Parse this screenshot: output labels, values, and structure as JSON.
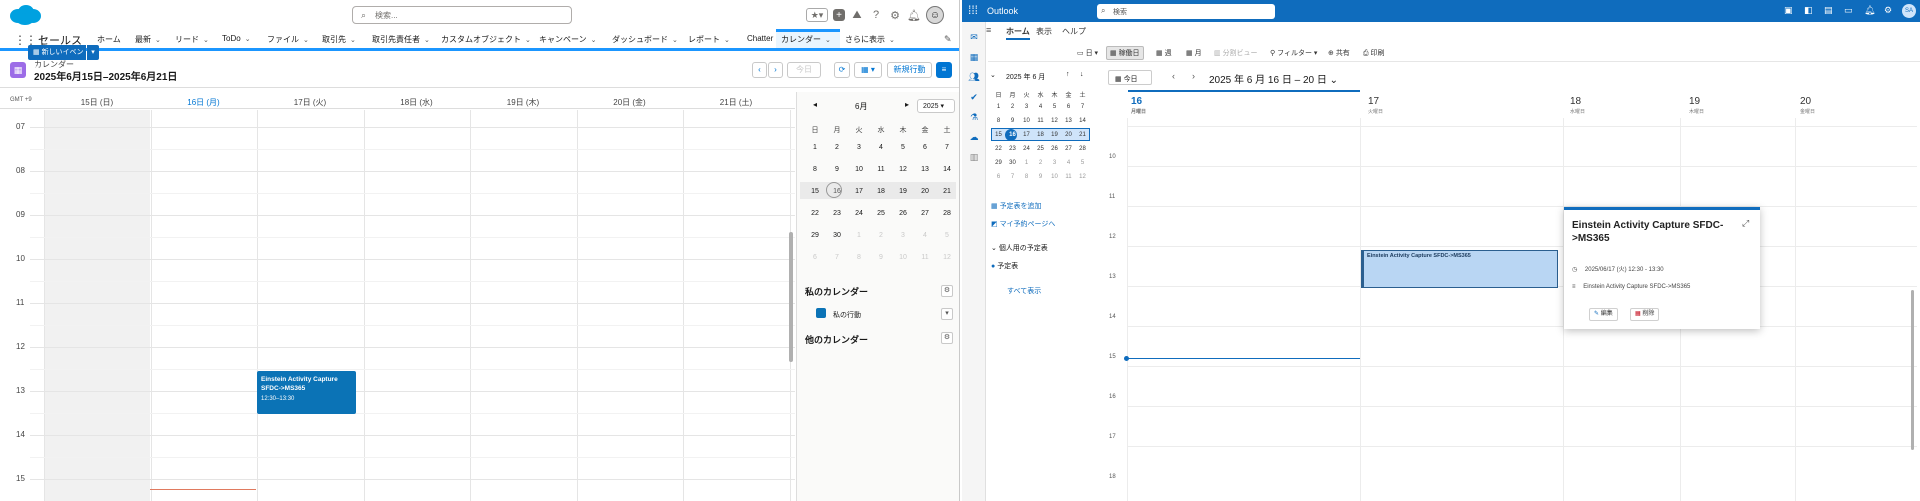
{
  "salesforce": {
    "app_name": "セールス",
    "search_placeholder": "検索...",
    "nav": [
      {
        "label": "ホーム",
        "dd": false
      },
      {
        "label": "最新",
        "dd": true
      },
      {
        "label": "リード",
        "dd": true
      },
      {
        "label": "ToDo",
        "dd": true
      },
      {
        "label": "ファイル",
        "dd": true
      },
      {
        "label": "取引先",
        "dd": true
      },
      {
        "label": "取引先責任者",
        "dd": true
      },
      {
        "label": "カスタムオブジェクト",
        "dd": true
      },
      {
        "label": "キャンペーン",
        "dd": true
      },
      {
        "label": "ダッシュボード",
        "dd": true
      },
      {
        "label": "レポート",
        "dd": true
      },
      {
        "label": "Chatter",
        "dd": false
      },
      {
        "label": "カレンダー",
        "dd": true
      },
      {
        "label": "さらに表示",
        "dd": true
      }
    ],
    "header": {
      "label": "カレンダー",
      "range": "2025年6月15日–2025年6月21日"
    },
    "buttons": {
      "today": "今日",
      "new_event": "新規行動"
    },
    "timezone": "GMT +9",
    "days": [
      "15日 (日)",
      "16日 (月)",
      "17日 (火)",
      "18日 (水)",
      "19日 (木)",
      "20日 (金)",
      "21日 (土)"
    ],
    "hours": [
      "07",
      "08",
      "09",
      "10",
      "11",
      "12",
      "13",
      "14",
      "15"
    ],
    "event": {
      "title": "Einstein Activity Capture SFDC->MS365",
      "time": "12:30–13:30"
    },
    "mini_cal": {
      "month": "6月",
      "year": "2025",
      "weekdays": [
        "日",
        "月",
        "火",
        "水",
        "木",
        "金",
        "土"
      ],
      "weeks": [
        [
          "1",
          "2",
          "3",
          "4",
          "5",
          "6",
          "7"
        ],
        [
          "8",
          "9",
          "10",
          "11",
          "12",
          "13",
          "14"
        ],
        [
          "15",
          "16",
          "17",
          "18",
          "19",
          "20",
          "21"
        ],
        [
          "22",
          "23",
          "24",
          "25",
          "26",
          "27",
          "28"
        ],
        [
          "29",
          "30",
          "1",
          "2",
          "3",
          "4",
          "5"
        ],
        [
          "6",
          "7",
          "8",
          "9",
          "10",
          "11",
          "12"
        ]
      ]
    },
    "my_calendars": "私のカレンダー",
    "my_cal_item": "私の行動",
    "other_calendars": "他のカレンダー"
  },
  "outlook": {
    "brand": "Outlook",
    "search_placeholder": "検索",
    "avatar": "SA",
    "tabs": [
      "ホーム",
      "表示",
      "ヘルプ"
    ],
    "ribbon": {
      "new_event": "新しいイベント",
      "day": "日",
      "workweek": "稼働日",
      "week": "週",
      "month": "月",
      "split": "分割ビュー",
      "filter": "フィルター",
      "share": "共有",
      "print": "印刷"
    },
    "mini_cal": {
      "title": "2025 年 6 月",
      "weekdays": [
        "日",
        "月",
        "火",
        "水",
        "木",
        "金",
        "土"
      ],
      "weeks": [
        [
          "1",
          "2",
          "3",
          "4",
          "5",
          "6",
          "7"
        ],
        [
          "8",
          "9",
          "10",
          "11",
          "12",
          "13",
          "14"
        ],
        [
          "15",
          "16",
          "17",
          "18",
          "19",
          "20",
          "21"
        ],
        [
          "22",
          "23",
          "24",
          "25",
          "26",
          "27",
          "28"
        ],
        [
          "29",
          "30",
          "1",
          "2",
          "3",
          "4",
          "5"
        ],
        [
          "6",
          "7",
          "8",
          "9",
          "10",
          "11",
          "12"
        ]
      ]
    },
    "links": {
      "add_calendar": "予定表を追加",
      "booking": "マイ予約ページへ",
      "personal": "個人用の予定表",
      "calendar": "予定表",
      "show_all": "すべて表示"
    },
    "today_btn": "今日",
    "range": "2025 年 6 月 16 日 – 20 日",
    "days": [
      {
        "num": "16",
        "name": "月曜日"
      },
      {
        "num": "17",
        "name": "火曜日"
      },
      {
        "num": "18",
        "name": "水曜日"
      },
      {
        "num": "19",
        "name": "木曜日"
      },
      {
        "num": "20",
        "name": "金曜日"
      }
    ],
    "hours": [
      "10",
      "11",
      "12",
      "13",
      "14",
      "15",
      "16",
      "17",
      "18"
    ],
    "event": {
      "title": "Einstein Activity Capture SFDC->MS365"
    },
    "popup": {
      "title": "Einstein Activity Capture SFDC->MS365",
      "time": "2025/06/17 (火) 12:30 - 13:30",
      "desc": "Einstein Activity Capture SFDC->MS365",
      "edit": "編集",
      "delete": "削除"
    }
  }
}
